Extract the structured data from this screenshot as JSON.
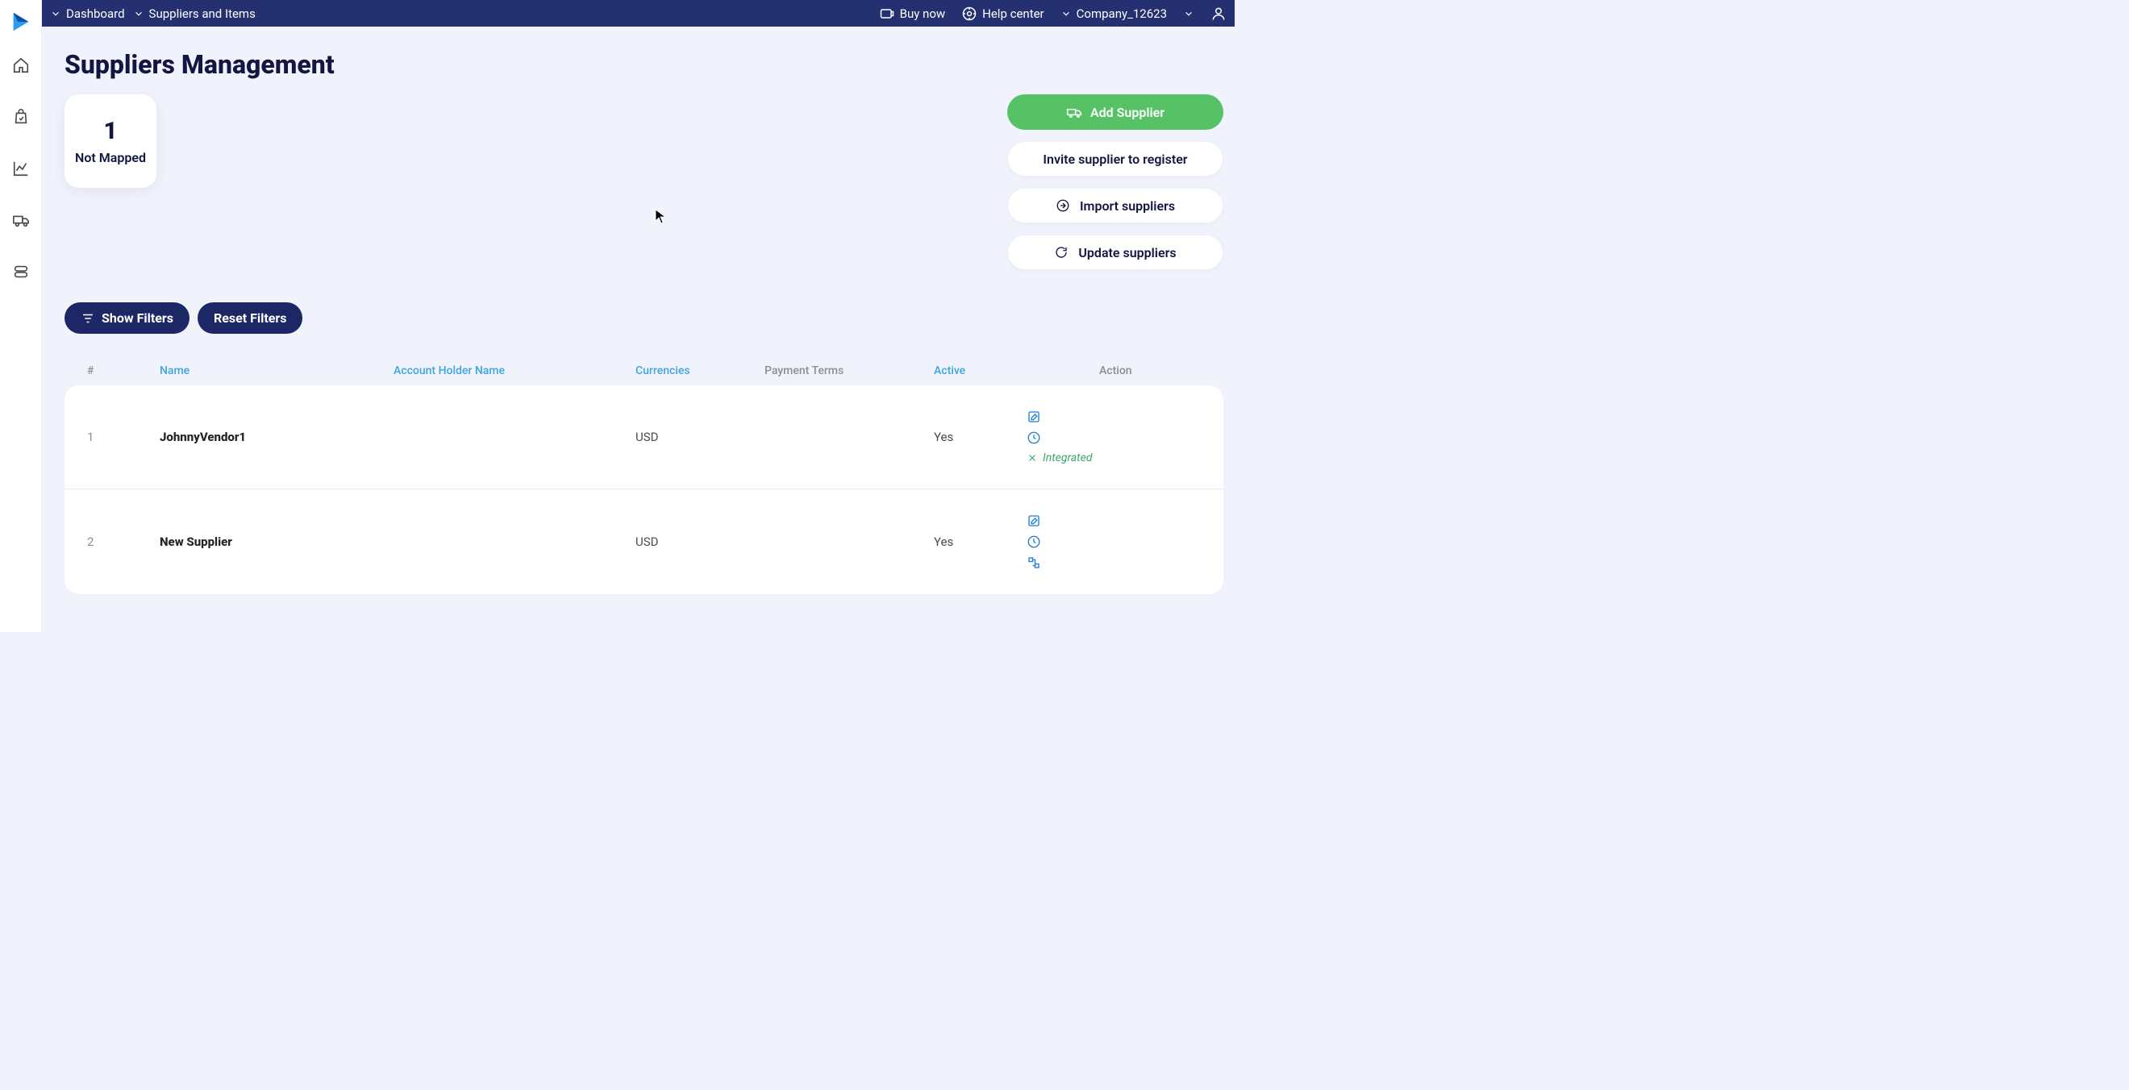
{
  "topbar": {
    "dashboard": "Dashboard",
    "suppliers_items": "Suppliers and Items",
    "buy_now": "Buy now",
    "help_center": "Help center",
    "company": "Company_12623"
  },
  "page": {
    "title": "Suppliers Management"
  },
  "stat": {
    "count": "1",
    "label": "Not Mapped"
  },
  "buttons": {
    "add_supplier": "Add Supplier",
    "invite": "Invite supplier to register",
    "import": "Import suppliers",
    "update": "Update suppliers",
    "show_filters": "Show Filters",
    "reset_filters": "Reset Filters"
  },
  "table": {
    "headers": {
      "idx": "#",
      "name": "Name",
      "acct": "Account Holder Name",
      "currencies": "Currencies",
      "payment_terms": "Payment Terms",
      "active": "Active",
      "action": "Action"
    },
    "rows": [
      {
        "idx": "1",
        "name": "JohnnyVendor1",
        "acct": "",
        "currency": "USD",
        "payment": "",
        "active": "Yes",
        "integrated": "Integrated"
      },
      {
        "idx": "2",
        "name": "New Supplier",
        "acct": "",
        "currency": "USD",
        "payment": "",
        "active": "Yes"
      }
    ]
  }
}
